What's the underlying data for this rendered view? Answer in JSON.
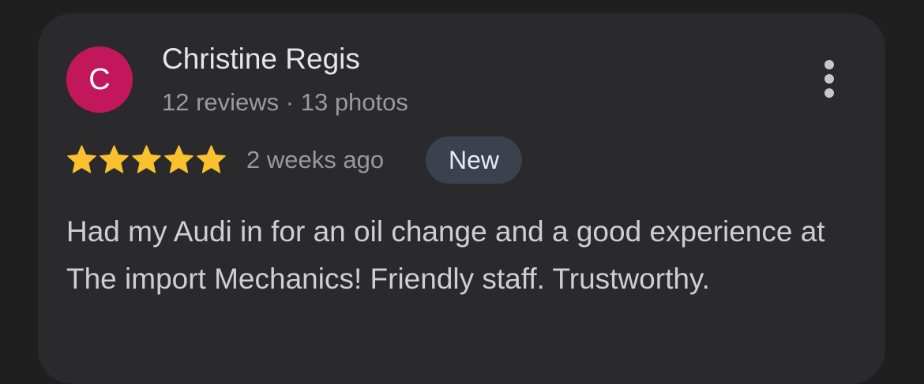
{
  "review": {
    "avatar_letter": "C",
    "avatar_color": "#c2185b",
    "reviewer_name": "Christine Regis",
    "reviewer_meta": "12 reviews · 13 photos",
    "rating": 5,
    "rating_max": 5,
    "star_color": "#fbc02d",
    "time_ago": "2 weeks ago",
    "badge_label": "New",
    "badge_color": "#3c4150",
    "text": "Had my Audi in for an oil change and a good experience at The import Mechanics! Friendly staff. Trustworthy.",
    "more_icon": "more-vert-icon"
  }
}
